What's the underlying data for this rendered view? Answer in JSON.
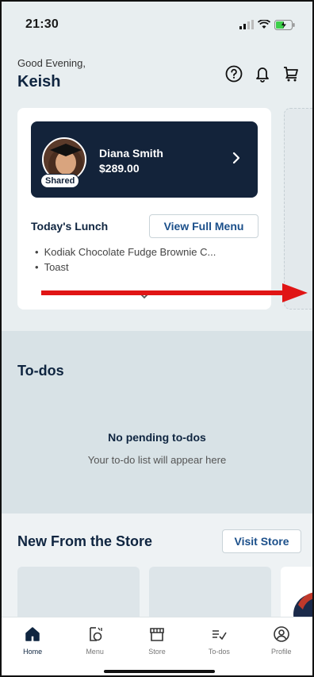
{
  "status_bar": {
    "time": "21:30"
  },
  "header": {
    "greeting": "Good Evening,",
    "user_name": "Keish"
  },
  "header_icons": [
    "help-icon",
    "bell-icon",
    "cart-icon"
  ],
  "account_card": {
    "name": "Diana Smith",
    "balance": "$289.00",
    "badge": "Shared"
  },
  "lunch": {
    "title": "Today's Lunch",
    "view_menu_label": "View Full Menu",
    "items": [
      "Kodiak Chocolate Fudge Brownie C...",
      "Toast"
    ]
  },
  "todos": {
    "title": "To-dos",
    "empty_title": "No pending to-dos",
    "empty_subtitle": "Your to-do list will appear here"
  },
  "store": {
    "title": "New From the Store",
    "visit_label": "Visit Store"
  },
  "tabs": [
    {
      "label": "Home",
      "icon": "home-icon",
      "active": true
    },
    {
      "label": "Menu",
      "icon": "menu-icon",
      "active": false
    },
    {
      "label": "Store",
      "icon": "store-icon",
      "active": false
    },
    {
      "label": "To-dos",
      "icon": "todos-icon",
      "active": false
    },
    {
      "label": "Profile",
      "icon": "profile-icon",
      "active": false
    }
  ],
  "colors": {
    "navy": "#13233a",
    "accent_blue": "#1b4f8a",
    "arrow_red": "#e01515"
  }
}
